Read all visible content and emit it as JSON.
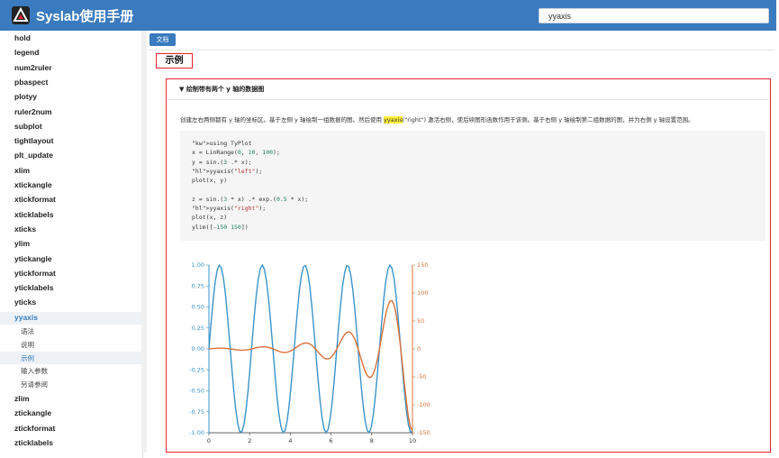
{
  "header": {
    "title": "Syslab使用手册",
    "search_value": "yyaxis",
    "accent": "#3a7bbf"
  },
  "sidebar": {
    "items": [
      {
        "label": "hold"
      },
      {
        "label": "legend"
      },
      {
        "label": "num2ruler"
      },
      {
        "label": "pbaspect"
      },
      {
        "label": "plotyy"
      },
      {
        "label": "ruler2num"
      },
      {
        "label": "subplot"
      },
      {
        "label": "tightlayout"
      },
      {
        "label": "plt_update"
      },
      {
        "label": "xlim"
      },
      {
        "label": "xtickangle"
      },
      {
        "label": "xtickformat"
      },
      {
        "label": "xticklabels"
      },
      {
        "label": "xticks"
      },
      {
        "label": "ylim"
      },
      {
        "label": "ytickangle"
      },
      {
        "label": "ytickformat"
      },
      {
        "label": "yticklabels"
      },
      {
        "label": "yticks"
      },
      {
        "label": "yyaxis",
        "active": true
      }
    ],
    "subitems": [
      {
        "label": "语法"
      },
      {
        "label": "说明"
      },
      {
        "label": "示例",
        "active": true
      },
      {
        "label": "输入参数"
      },
      {
        "label": "另请参阅"
      }
    ],
    "items_after": [
      {
        "label": "zlim"
      },
      {
        "label": "ztickangle"
      },
      {
        "label": "ztickformat"
      },
      {
        "label": "zticklabels"
      }
    ]
  },
  "main": {
    "doc_button": "文档",
    "section_title": "示例",
    "example_title": "▼ 绘制带有两个 y 轴的数据图",
    "description": {
      "before": "创建左右两侧都有 y 轴的坐标区。基于左侧 y 轴绘制一组数据的图。然后使用 ",
      "highlight": "yyaxis",
      "after": "(\"right\") 激活右侧，使后续图形函数作用于该侧。基于右侧 y 轴绘制第二组数据的图，并为右侧 y 轴设置范围。"
    },
    "code": [
      "using TyPlot",
      "x = LinRange(0, 10, 100);",
      "y = sin.(3 .* x);",
      "yyaxis(\"left\");",
      "plot(x, y)",
      "",
      "z = sin.(3 * x) .* exp.(0.5 * x);",
      "yyaxis(\"right\");",
      "plot(x, z)",
      "ylim([-150 150])"
    ]
  },
  "chart_data": {
    "type": "line",
    "x_ticks": [
      "0",
      "2",
      "4",
      "6",
      "8",
      "10"
    ],
    "y_left_ticks": [
      "1.00",
      "0.75",
      "0.50",
      "0.25",
      "0.00",
      "-0.25",
      "-0.50",
      "-0.75",
      "-1.00"
    ],
    "y_right_ticks": [
      "150",
      "100",
      "50",
      "0",
      "-50",
      "-100",
      "-150"
    ],
    "xlim": [
      0,
      10
    ],
    "ylim_left": [
      -1,
      1
    ],
    "ylim_right": [
      -150,
      150
    ],
    "series": [
      {
        "axis": "left",
        "color": "#3b93c8",
        "function": "sin(3x)"
      },
      {
        "axis": "right",
        "color": "#d9703a",
        "function": "sin(3x)*exp(0.5x)"
      }
    ]
  }
}
